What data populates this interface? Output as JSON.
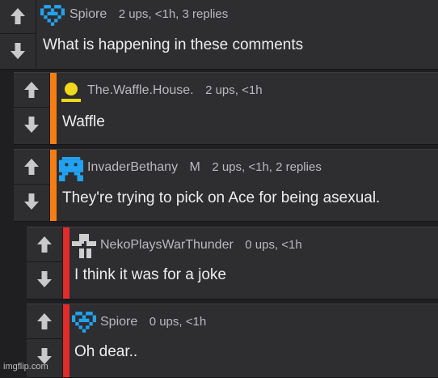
{
  "colors": {
    "background": "#1f1f21",
    "card": "#2e2e30",
    "orange_bar": "#f57d14",
    "red_bar": "#e22b2b",
    "avatar_blue": "#22a2f2",
    "avatar_yellow": "#f2d81c",
    "avatar_gray": "#cfcfcf"
  },
  "comments": [
    {
      "username": "Spiore",
      "badge": "",
      "meta": "2 ups, <1h, 3 replies",
      "text": "What is happening in these comments",
      "avatar_icon": "pixel-heart-icon",
      "bar": "none"
    },
    {
      "username": "The.Waffle.House.",
      "badge": "",
      "meta": "2 ups, <1h",
      "text": "Waffle",
      "avatar_icon": "user-silhouette-icon",
      "bar": "orange"
    },
    {
      "username": "InvaderBethany",
      "badge": "M",
      "meta": "2 ups, <1h, 2 replies",
      "text": "They're trying to pick on Ace for being asexual.",
      "avatar_icon": "space-invader-icon",
      "bar": "orange"
    },
    {
      "username": "NekoPlaysWarThunder",
      "badge": "",
      "meta": "0 ups, <1h",
      "text": "I think it was for a joke",
      "avatar_icon": "pixel-cross-icon",
      "bar": "red"
    },
    {
      "username": "Spiore",
      "badge": "",
      "meta": "0 ups, <1h",
      "text": "Oh dear..",
      "avatar_icon": "pixel-heart-icon",
      "bar": "red"
    }
  ],
  "watermark": "imgflip.com"
}
